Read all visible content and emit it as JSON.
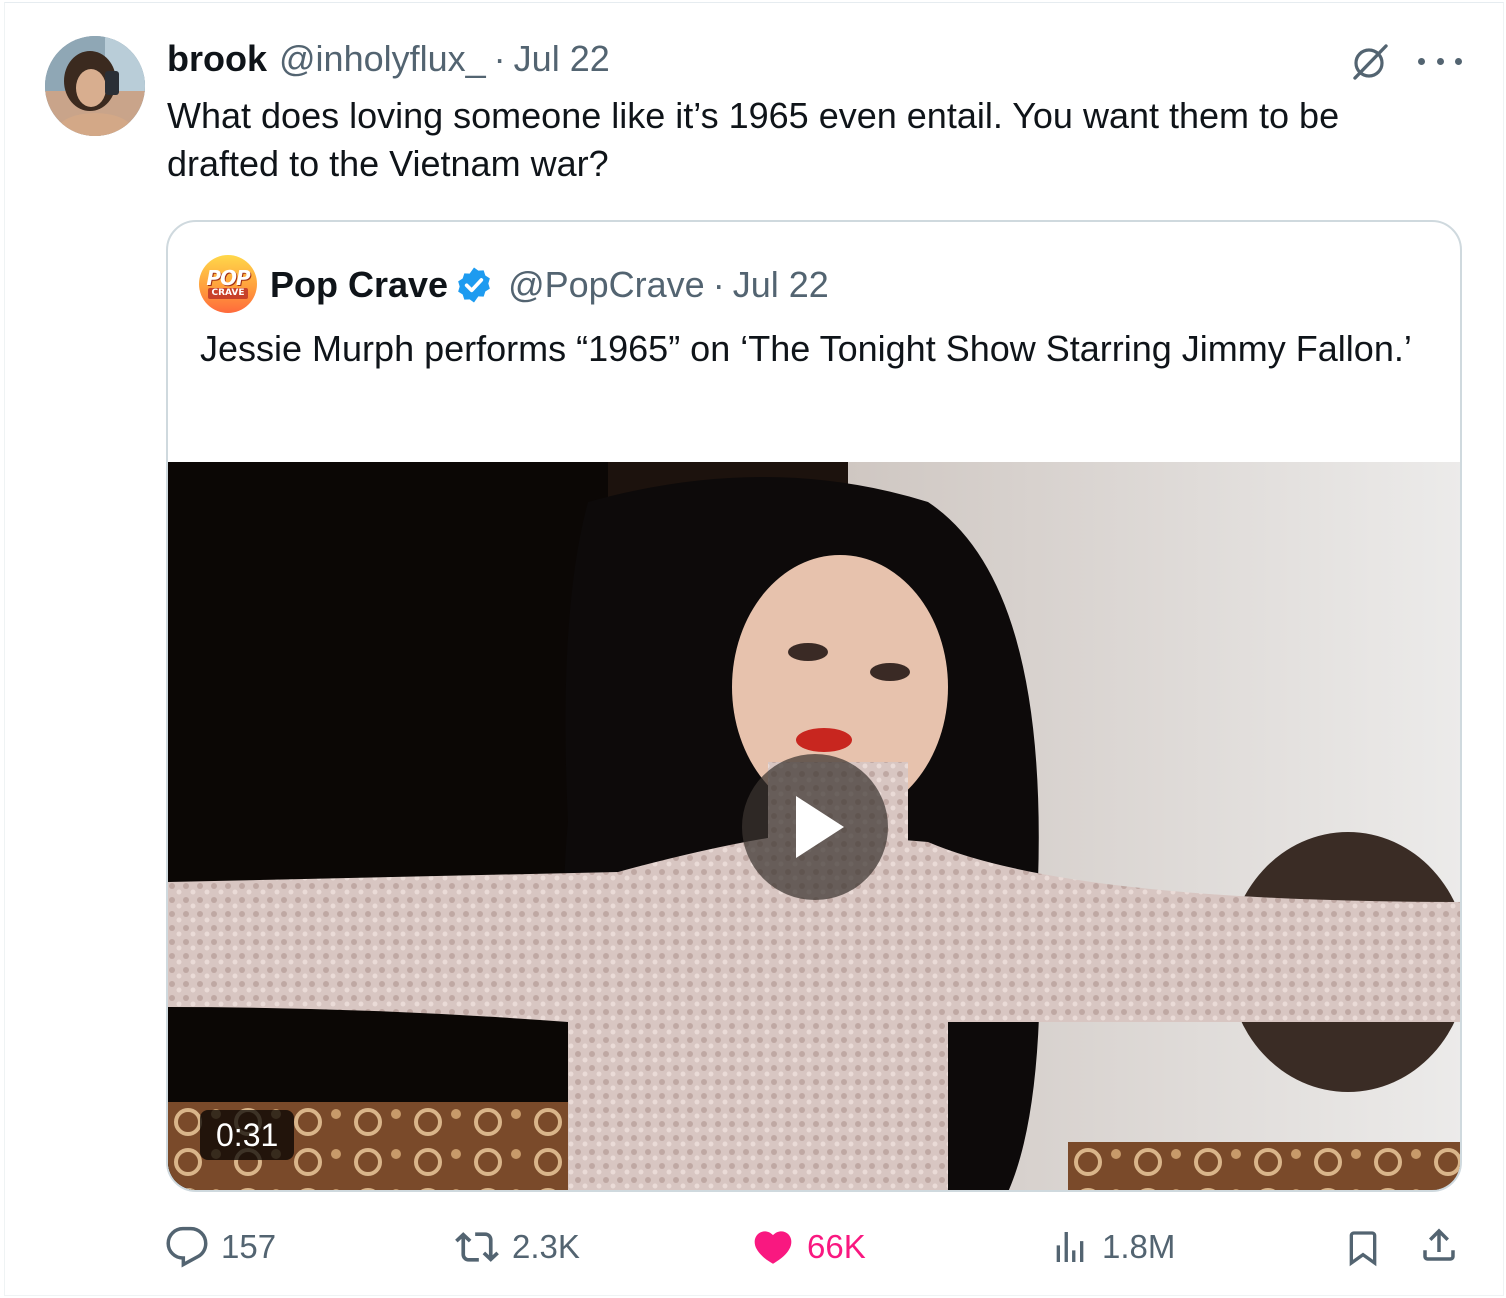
{
  "tweet": {
    "author_name": "brook",
    "author_handle": "@inholyflux_",
    "separator": "·",
    "date": "Jul 22",
    "text": "What does loving someone like it’s 1965 even entail. You want them to be drafted to the Vietnam war?",
    "avatar_icon": "avatar-photo",
    "grok_icon": "grok-icon",
    "more_icon": "more-options-icon"
  },
  "quote": {
    "logo_top": "POP",
    "logo_bottom": "CRAVE",
    "author_name": "Pop Crave",
    "verified_icon": "verified-badge-icon",
    "verified_color": "#1d9bf0",
    "author_handle": "@PopCrave",
    "separator": "·",
    "date": "Jul 22",
    "text": "Jessie Murph performs “1965” on ‘The Tonight Show Starring Jimmy Fallon.’",
    "video": {
      "duration": "0:31",
      "play_icon": "play-icon"
    }
  },
  "actions": {
    "replies": "157",
    "reposts": "2.3K",
    "likes": "66K",
    "views": "1.8M",
    "like_color": "#f91880",
    "icon_color": "#536471",
    "icons": [
      "reply-icon",
      "repost-icon",
      "like-heart-icon",
      "views-icon",
      "bookmark-icon",
      "share-icon"
    ]
  }
}
